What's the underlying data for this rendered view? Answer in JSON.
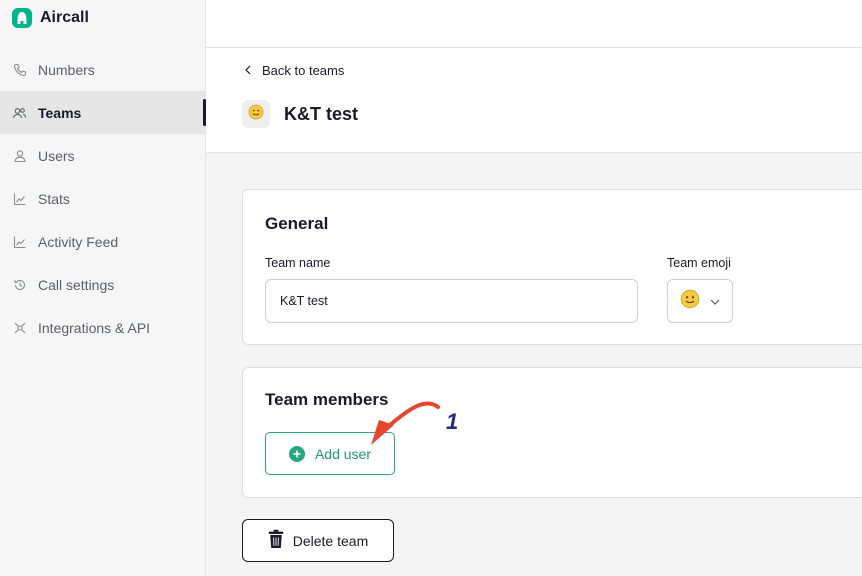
{
  "app": {
    "name": "Aircall",
    "brand_color": "#00b388"
  },
  "sidebar": {
    "items": [
      {
        "label": "Numbers",
        "icon": "phone-icon"
      },
      {
        "label": "Teams",
        "icon": "team-icon",
        "active": true
      },
      {
        "label": "Users",
        "icon": "user-icon"
      },
      {
        "label": "Stats",
        "icon": "chart-icon"
      },
      {
        "label": "Activity Feed",
        "icon": "activity-icon"
      },
      {
        "label": "Call settings",
        "icon": "history-icon"
      },
      {
        "label": "Integrations & API",
        "icon": "integrations-icon"
      }
    ]
  },
  "header": {
    "back_label": "Back to teams",
    "title": "K&T test",
    "title_emoji": "🙂"
  },
  "general": {
    "title": "General",
    "team_name_label": "Team name",
    "team_name_value": "K&T test",
    "team_emoji_label": "Team emoji",
    "team_emoji_value": "🙂"
  },
  "members": {
    "title": "Team members",
    "add_user_label": "Add user"
  },
  "delete_label": "Delete team",
  "annotation": {
    "step": "1",
    "arrow_color": "#e8442e"
  }
}
